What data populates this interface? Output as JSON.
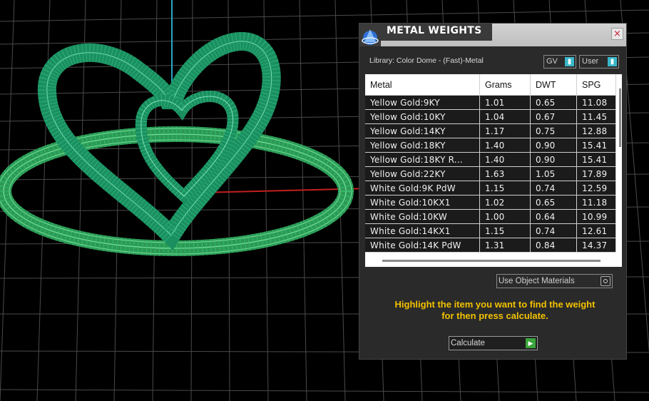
{
  "panel": {
    "title": "METAL WEIGHTS",
    "close_label": "×",
    "library_label": "Library: Color Dome - (Fast)-Metal",
    "dropdown_gv": "GV",
    "dropdown_user": "User",
    "table": {
      "headers": [
        "Metal",
        "Grams",
        "DWT",
        "SPG"
      ],
      "rows": [
        [
          "Yellow Gold:9KY",
          "1.01",
          "0.65",
          "11.08"
        ],
        [
          "Yellow Gold:10KY",
          "1.04",
          "0.67",
          "11.45"
        ],
        [
          "Yellow Gold:14KY",
          "1.17",
          "0.75",
          "12.88"
        ],
        [
          "Yellow Gold:18KY",
          "1.40",
          "0.90",
          "15.41"
        ],
        [
          "Yellow Gold:18KY R...",
          "1.40",
          "0.90",
          "15.41"
        ],
        [
          "Yellow Gold:22KY",
          "1.63",
          "1.05",
          "17.89"
        ],
        [
          "White Gold:9K PdW",
          "1.15",
          "0.74",
          "12.59"
        ],
        [
          "White Gold:10KX1",
          "1.02",
          "0.65",
          "11.18"
        ],
        [
          "White Gold:10KW",
          "1.00",
          "0.64",
          "10.99"
        ],
        [
          "White Gold:14KX1",
          "1.15",
          "0.74",
          "12.61"
        ],
        [
          "White Gold:14K PdW",
          "1.31",
          "0.84",
          "14.37"
        ]
      ]
    },
    "use_object_materials": "Use Object Materials",
    "hint_line1": "Highlight the item you want to find the weight",
    "hint_line2": "for then press calculate.",
    "calculate_label": "Calculate"
  },
  "colors": {
    "hint": "#f2c200",
    "model_wire": "#1f9a6a",
    "ring_wire": "#3bbb70"
  },
  "icons": [
    "app-logo-icon",
    "close-icon",
    "dropdown-arrow-icon",
    "radio-icon",
    "play-icon"
  ]
}
